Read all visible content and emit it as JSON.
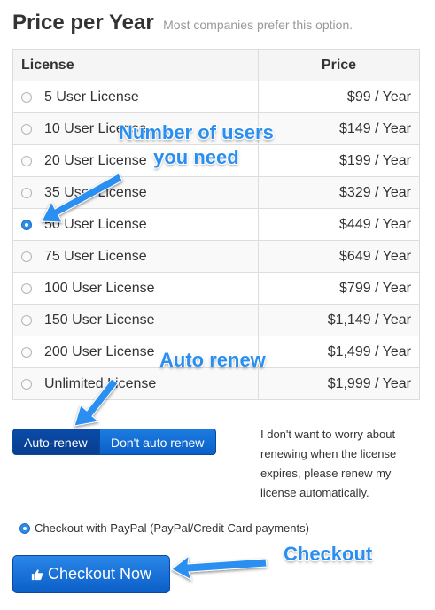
{
  "header": {
    "title": "Price per Year",
    "subtitle": "Most companies prefer this option."
  },
  "table": {
    "headers": {
      "license": "License",
      "price": "Price"
    },
    "rows": [
      {
        "license": "5 User License",
        "price": "$99 / Year",
        "selected": false
      },
      {
        "license": "10 User License",
        "price": "$149 / Year",
        "selected": false
      },
      {
        "license": "20 User License",
        "price": "$199 / Year",
        "selected": false
      },
      {
        "license": "35 User License",
        "price": "$329 / Year",
        "selected": false
      },
      {
        "license": "50 User License",
        "price": "$449 / Year",
        "selected": true
      },
      {
        "license": "75 User License",
        "price": "$649 / Year",
        "selected": false
      },
      {
        "license": "100 User License",
        "price": "$799 / Year",
        "selected": false
      },
      {
        "license": "150 User License",
        "price": "$1,149 / Year",
        "selected": false
      },
      {
        "license": "200 User License",
        "price": "$1,499 / Year",
        "selected": false
      },
      {
        "license": "Unlimited License",
        "price": "$1,999 / Year",
        "selected": false
      }
    ]
  },
  "renew": {
    "auto_label": "Auto-renew",
    "no_auto_label": "Don't auto renew",
    "selected": "Auto-renew",
    "description": "I don't want to worry about renewing when the license expires, please renew my license automatically."
  },
  "payment": {
    "paypal_label": "Checkout with PayPal (PayPal/Credit Card payments)",
    "selected": true
  },
  "checkout": {
    "button_label": "Checkout Now",
    "icon": "thumbs-up-icon"
  },
  "annotations": {
    "users_line1": "Number of users",
    "users_line2": "you need",
    "renew": "Auto renew",
    "checkout": "Checkout"
  },
  "colors": {
    "primary_button": "#0b5fc8",
    "annotation": "#2b8ff0",
    "radio_checked": "#2d8ce8"
  }
}
